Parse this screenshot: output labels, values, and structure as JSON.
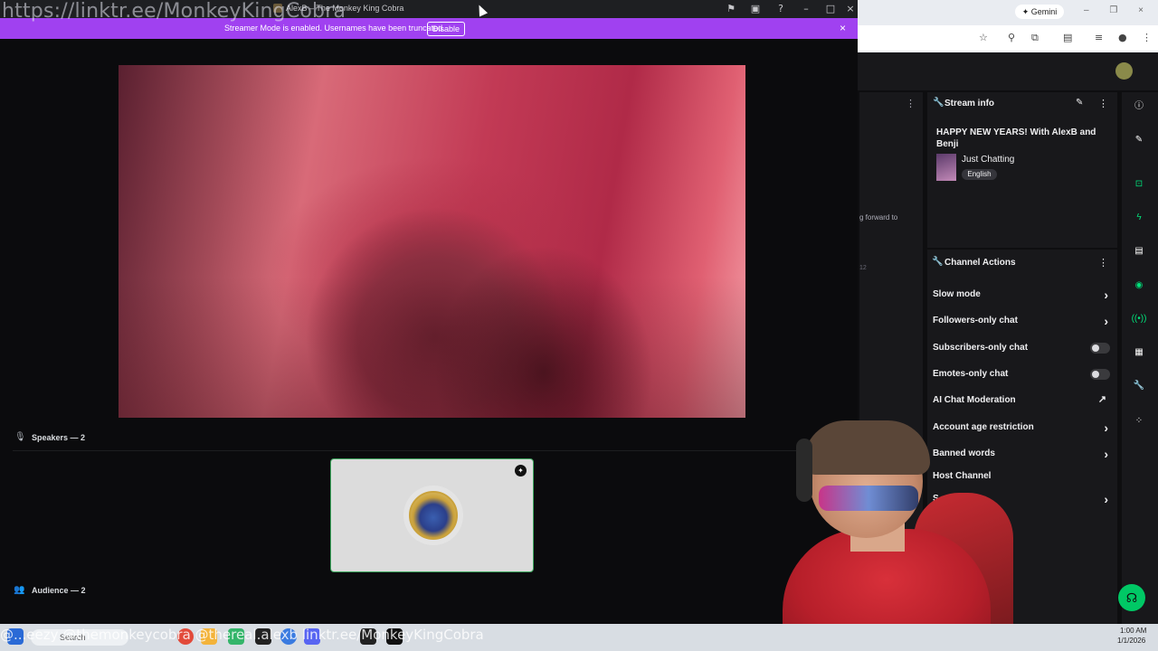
{
  "overlay": {
    "link_top": "https://linktr.ee/MonkeyKingCobra",
    "bottom_overlay": "@...eezy   @themonkeycobra   @thereal.alexb   linktr.ee/MonkeyKingCobra"
  },
  "discord": {
    "window_title": "AlexB – The Monkey King Cobra",
    "banner_text": "Streamer Mode is enabled. Usernames have been truncated.",
    "banner_button": "Disable",
    "speakers_label": "Speakers — 2",
    "audience_label": "Audience — 2"
  },
  "browser": {
    "gemini_label": "Gemini"
  },
  "twitch": {
    "stream_info": {
      "heading": "Stream info",
      "title": "HAPPY NEW YEARS! With AlexB and Benji",
      "category": "Just Chatting",
      "language": "English"
    },
    "chat_fragments": [
      "g forward to",
      "12"
    ],
    "channel_actions": {
      "heading": "Channel Actions",
      "items": [
        {
          "label": "Slow mode",
          "control": "chevron"
        },
        {
          "label": "Followers-only chat",
          "control": "chevron"
        },
        {
          "label": "Subscribers-only chat",
          "control": "toggle-off"
        },
        {
          "label": "Emotes-only chat",
          "control": "toggle-off"
        },
        {
          "label": "AI Chat Moderation",
          "control": "external"
        },
        {
          "label": "Account age restriction",
          "control": "chevron"
        },
        {
          "label": "Banned words",
          "control": "chevron"
        },
        {
          "label": "Host Channel",
          "control": "none"
        },
        {
          "label": "S",
          "control": "chevron"
        }
      ]
    }
  },
  "taskbar": {
    "search_placeholder": "Search",
    "time": "1:00 AM",
    "date": "1/1/2026"
  },
  "colors": {
    "streamer_banner": "#a041f0",
    "twitch_bg": "#18181b",
    "accent_green": "#00e07a"
  }
}
